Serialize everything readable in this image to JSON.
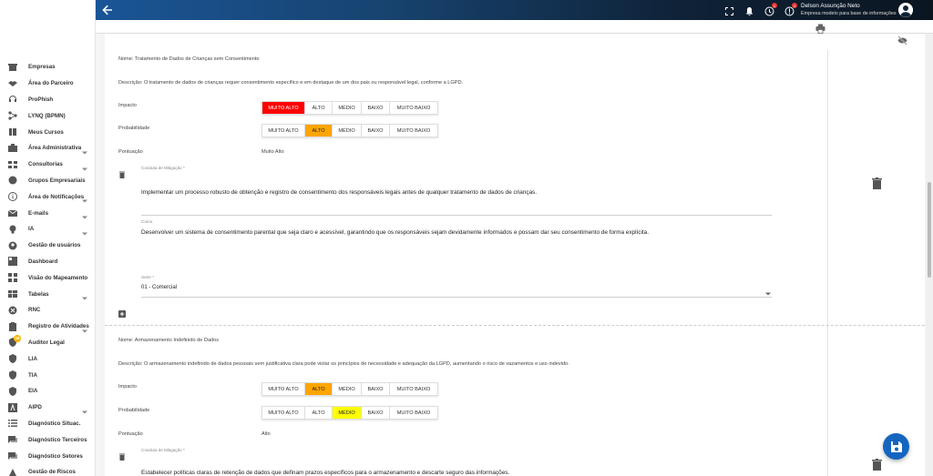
{
  "sidebar": {
    "items": [
      {
        "label": "Empresas",
        "icon": "building-icon",
        "chevron": false
      },
      {
        "label": "Área do Parceiro",
        "icon": "handshake-icon",
        "chevron": false
      },
      {
        "label": "ProPhish",
        "icon": "headset-icon",
        "chevron": false
      },
      {
        "label": "LYNQ (BPMN)",
        "icon": "flow-icon",
        "chevron": false
      },
      {
        "label": "Meus Cursos",
        "icon": "book-icon",
        "chevron": false
      },
      {
        "label": "Área Administrativa",
        "icon": "admin-icon",
        "chevron": true
      },
      {
        "label": "Consultorias",
        "icon": "grid-icon",
        "chevron": true
      },
      {
        "label": "Grupos Empresariais",
        "icon": "globe-icon",
        "chevron": false
      },
      {
        "label": "Área de Notificações",
        "icon": "info-icon",
        "chevron": true
      },
      {
        "label": "E-mails",
        "icon": "mail-icon",
        "chevron": true
      },
      {
        "label": "IA",
        "icon": "bulb-icon",
        "chevron": true
      },
      {
        "label": "Gestão de usuários",
        "icon": "user-icon",
        "chevron": false
      },
      {
        "label": "Dashboard",
        "icon": "dashboard-icon",
        "chevron": false
      },
      {
        "label": "Visão do Mapeamento",
        "icon": "map-view-icon",
        "chevron": false
      },
      {
        "label": "Tabelas",
        "icon": "table-icon",
        "chevron": true
      },
      {
        "label": "RNC",
        "icon": "close-circle-icon",
        "chevron": false
      },
      {
        "label": "Registro de Atividades",
        "icon": "clipboard-icon",
        "chevron": true
      },
      {
        "label": "Auditor Legal",
        "icon": "shield-icon",
        "chevron": false,
        "badge": "18"
      },
      {
        "label": "LIA",
        "icon": "shield-icon",
        "chevron": false
      },
      {
        "label": "TIA",
        "icon": "shield-icon",
        "chevron": false
      },
      {
        "label": "EIA",
        "icon": "shield-icon",
        "chevron": false
      },
      {
        "label": "AIPD",
        "icon": "aipd-icon",
        "chevron": true
      },
      {
        "label": "Diagnóstico Situac.",
        "icon": "list-icon",
        "chevron": false
      },
      {
        "label": "Diagnóstico Terceiros",
        "icon": "chat-icon",
        "chevron": false
      },
      {
        "label": "Diagnóstico Setores",
        "icon": "chat-icon",
        "chevron": false
      },
      {
        "label": "Gestão de Riscos",
        "icon": "risk-icon",
        "chevron": false
      }
    ]
  },
  "topbar": {
    "user_name": "Delson Assunção Neto",
    "user_company": "Empresa modelo para base de informações",
    "badge_updates": "1",
    "badge_alerts": "1"
  },
  "risks": [
    {
      "name": "Nome: Tratamento de Dados de Crianças sem Consentimento",
      "description": "Descrição: O tratamento de dados de crianças requer consentimento específico e em destaque de um dos pais ou responsável legal, conforme a LGPD.",
      "impact_label": "Impacto",
      "probability_label": "Probabilidade",
      "score_label": "Pontuação",
      "score_value": "Muito Alto",
      "mitigation_label": "Conduta de Mitigação *",
      "mitigation_text": "Implementar um processo robusto de obtenção e registro de consentimento dos responsáveis legais antes de qualquer tratamento de dados de crianças.",
      "how_label": "Como",
      "how_text": "Desenvolver um sistema de consentimento parental que seja claro e acessível, garantindo que os responsáveis sejam devidamente informados e possam dar seu consentimento de forma explícita.",
      "sector_label": "Setor *",
      "sector_value": "01 - Comercial"
    },
    {
      "name": "Nome: Armazenamento Indefinido de Dados",
      "description": "Descrição: O armazenamento indefinido de dados pessoais sem justificativa clara pode violar os princípios de necessidade e adequação da LGPD, aumentando o risco de vazamentos e uso indevido.",
      "impact_label": "Impacto",
      "probability_label": "Probabilidade",
      "score_label": "Pontuação",
      "score_value": "Alto",
      "mitigation_label": "Conduta de Mitigação *",
      "mitigation_text": "Estabelecer políticas claras de retenção de dados que definam prazos específicos para o armazenamento e descarte seguro das informações."
    }
  ],
  "levels": {
    "very_high": "MUITO ALTO",
    "high": "ALTO",
    "medium": "MÉDIO",
    "low": "BAIXO",
    "very_low": "MUITO BAIXO"
  },
  "colors": {
    "very_high_selected": "#ff0000",
    "high_selected": "#ffa500",
    "medium_selected": "#ffff00",
    "primary": "#1565c0"
  }
}
